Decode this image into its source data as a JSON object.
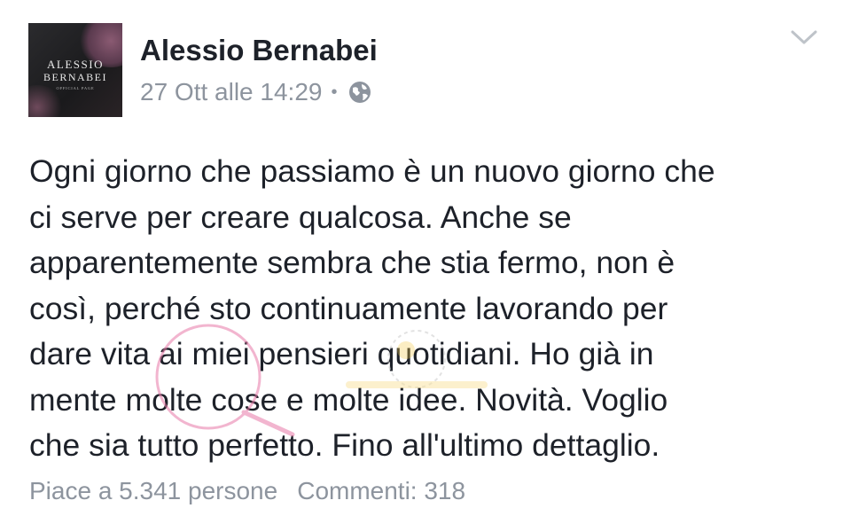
{
  "post": {
    "author": "Alessio Bernabei",
    "avatar_logo": {
      "line1": "ALESSIO",
      "line2": "BERNABEI",
      "line3": "OFFICIAL PAGE"
    },
    "date": "27 Ott alle 14:29",
    "separator": "•",
    "privacy_icon": "globe-icon",
    "menu_icon": "chevron-down-icon",
    "text_lines": [
      "Ogni giorno che passiamo è un nuovo giorno che",
      "ci serve per creare qualcosa. Anche se",
      "apparentemente sembra che stia fermo, non è",
      "così, perché sto continuamente lavorando per",
      "dare vita ai miei pensieri quotidiani. Ho già in",
      "mente molte cose e molte idee. Novità. Voglio",
      "che sia tutto perfetto. Fino all'ultimo dettaglio."
    ],
    "likes": "Piace a 5.341 persone",
    "comments": "Commenti: 318"
  },
  "colors": {
    "text": "#1d2129",
    "meta": "#8d949e",
    "watermark": "#e87aa8"
  }
}
